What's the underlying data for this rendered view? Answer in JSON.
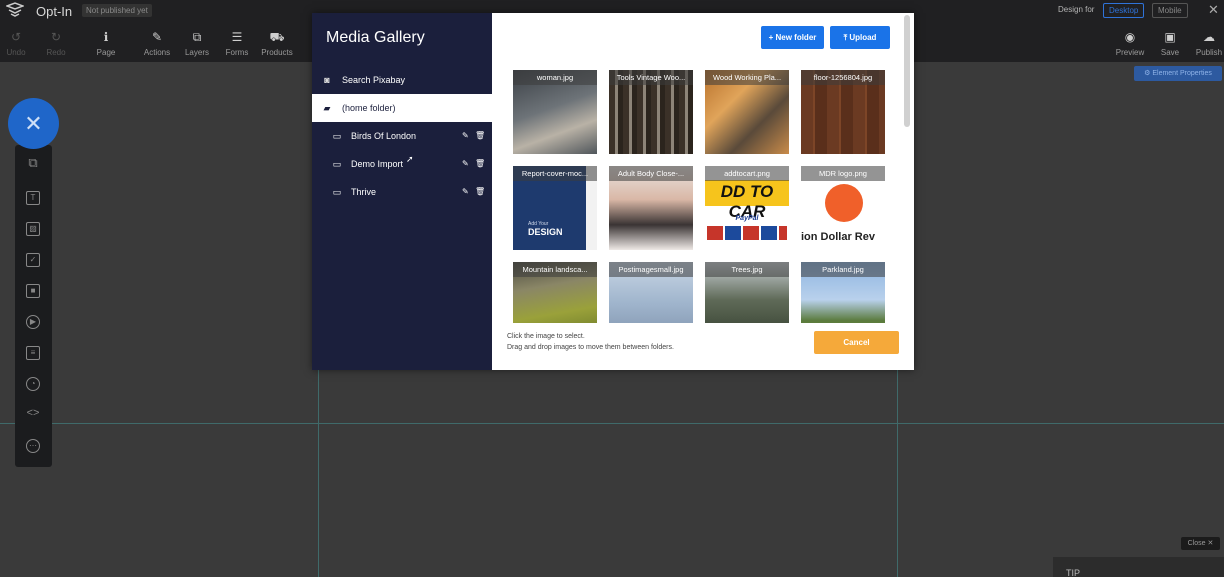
{
  "topbar": {
    "title": "Opt-In",
    "status_badge": "Not published yet",
    "tools_left": [
      {
        "label": "Undo",
        "icon": "undo-icon",
        "glyph": "↺"
      },
      {
        "label": "Redo",
        "icon": "redo-icon",
        "glyph": "↻"
      },
      {
        "label": "Page",
        "icon": "info-icon",
        "glyph": "ℹ"
      },
      {
        "label": "Actions",
        "icon": "wand-icon",
        "glyph": "✎"
      },
      {
        "label": "Layers",
        "icon": "layers-icon",
        "glyph": "⧉"
      },
      {
        "label": "Forms",
        "icon": "forms-icon",
        "glyph": "☰"
      },
      {
        "label": "Products",
        "icon": "cart-icon",
        "glyph": "⛟"
      }
    ],
    "tools_right": [
      {
        "label": "Preview",
        "icon": "eye-icon",
        "glyph": "◉"
      },
      {
        "label": "Save",
        "icon": "save-icon",
        "glyph": "▣"
      },
      {
        "label": "Publish",
        "icon": "cloud-upload-icon",
        "glyph": "☁"
      }
    ],
    "design_for_label": "Design for",
    "device_desktop": "Desktop",
    "device_mobile": "Mobile",
    "close_glyph": "✕"
  },
  "canvas": {
    "element_properties": "⚙ Element Properties",
    "fab_glyph": "✕",
    "close_label": "Close ✕",
    "tip_label": "TIP"
  },
  "left_toolbar": [
    {
      "icon": "puzzle-icon",
      "glyph": "⧉"
    },
    {
      "icon": "text-icon",
      "glyph": "T"
    },
    {
      "icon": "image-icon",
      "glyph": "▨"
    },
    {
      "icon": "checkbox-icon",
      "glyph": "✓"
    },
    {
      "icon": "box-icon",
      "glyph": "■"
    },
    {
      "icon": "play-icon",
      "glyph": "▶"
    },
    {
      "icon": "list-icon",
      "glyph": "≡"
    },
    {
      "icon": "timer-icon",
      "glyph": "◔"
    },
    {
      "icon": "code-icon",
      "glyph": "<>"
    },
    {
      "icon": "more-icon",
      "glyph": "⋯"
    }
  ],
  "media_gallery": {
    "title": "Media Gallery",
    "sidebar": {
      "search_pixabay": "Search Pixabay",
      "home_folder": "(home folder)",
      "folders": [
        "Birds Of London",
        "Demo Import",
        "Thrive"
      ]
    },
    "new_folder_label": "+ New folder",
    "upload_label": "⤒ Upload",
    "images": [
      {
        "name": "woman.jpg"
      },
      {
        "name": "Tools Vintage Woo..."
      },
      {
        "name": "Wood Working Pla..."
      },
      {
        "name": "floor-1256804.jpg"
      },
      {
        "name": "Report-cover-moc...",
        "overlay_small": "Add Your",
        "overlay_text": "DESIGN"
      },
      {
        "name": "Adult Body Close-..."
      },
      {
        "name": "addtocart.png",
        "overlay_text": "DD TO CAR",
        "overlay_small": "PayPal"
      },
      {
        "name": "MDR logo.png",
        "overlay_text": "ion Dollar Rev"
      },
      {
        "name": "Mountain landsca..."
      },
      {
        "name": "Postimagesmall.jpg"
      },
      {
        "name": "Trees.jpg"
      },
      {
        "name": "Parkland.jpg"
      }
    ],
    "help_line1": "Click the image to select.",
    "help_line2": "Drag and drop images to move them between folders.",
    "cancel_label": "Cancel"
  },
  "colors": {
    "sidebar_bg": "#1b1f3c",
    "primary_blue": "#1a73e8",
    "cancel_orange": "#f5a93a"
  }
}
